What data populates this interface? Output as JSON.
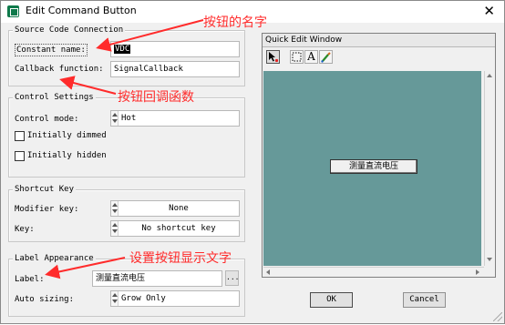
{
  "window": {
    "title": "Edit Command Button",
    "close_symbol": "✕"
  },
  "source": {
    "group_title": "Source Code Connection",
    "constant_name_label": "Constant name:",
    "constant_name_value": "VDC",
    "callback_label": "Callback function:",
    "callback_value": "SignalCallback"
  },
  "control": {
    "group_title": "Control Settings",
    "mode_label": "Control mode:",
    "mode_value": "Hot",
    "initially_dimmed_label": "Initially dimmed",
    "initially_dimmed_checked": false,
    "initially_hidden_label": "Initially hidden",
    "initially_hidden_checked": false
  },
  "shortcut": {
    "group_title": "Shortcut Key",
    "modifier_label": "Modifier key:",
    "modifier_value": "None",
    "key_label": "Key:",
    "key_value": "No shortcut key"
  },
  "label_appearance": {
    "group_title": "Label Appearance",
    "label_label": "Label:",
    "label_value": "测量直流电压",
    "ellipsis": "...",
    "autosizing_label": "Auto sizing:",
    "autosizing_value": "Grow Only"
  },
  "quick_edit": {
    "title": "Quick Edit Window",
    "tools": [
      "pointer-tool-icon",
      "select-rect-tool-icon",
      "text-tool-icon",
      "color-picker-tool-icon"
    ],
    "text_tool_glyph": "A",
    "canvas_color": "#669999",
    "canvas_button_label": "测量直流电压"
  },
  "buttons": {
    "ok": "OK",
    "cancel": "Cancel"
  },
  "annotations": {
    "name_note": "按钮的名字",
    "callback_note": "按钮回调函数",
    "label_note": "设置按钮显示文字",
    "color": "#ff2b2b"
  }
}
